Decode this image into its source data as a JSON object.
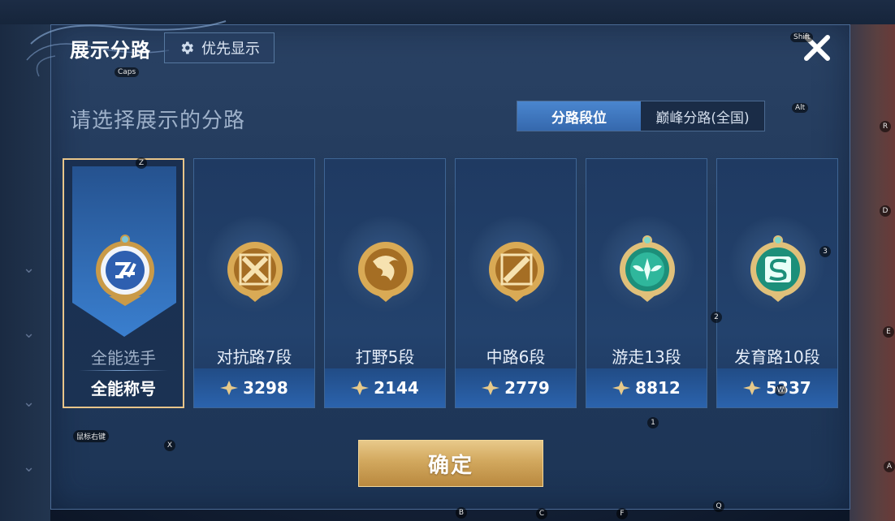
{
  "dialog": {
    "title": "展示分路",
    "priority_label": "优先显示",
    "subtitle": "请选择展示的分路",
    "tabs": [
      {
        "label": "分路段位",
        "active": true
      },
      {
        "label": "巅峰分路(全国)",
        "active": false
      }
    ],
    "confirm_label": "确定"
  },
  "cards": [
    {
      "name": "全能选手",
      "bottom": "全能称号",
      "selected": true,
      "icon": "all-round-badge-icon"
    },
    {
      "name": "对抗路7段",
      "score": "3298",
      "icon": "clash-lane-badge-icon"
    },
    {
      "name": "打野5段",
      "score": "2144",
      "icon": "jungle-badge-icon"
    },
    {
      "name": "中路6段",
      "score": "2779",
      "icon": "mid-lane-badge-icon"
    },
    {
      "name": "游走13段",
      "score": "8812",
      "icon": "roam-badge-icon"
    },
    {
      "name": "发育路10段",
      "score": "5337",
      "icon": "farm-lane-badge-icon"
    }
  ],
  "key_hints": {
    "caps": "Caps",
    "shift": "Shift",
    "alt": "Alt",
    "r": "R",
    "d": "D",
    "e": "E",
    "a": "A",
    "z": "Z",
    "x": "X",
    "b": "B",
    "c": "C",
    "f": "F",
    "q": "Q",
    "w": "W",
    "n1": "1",
    "n2": "2",
    "n3": "3",
    "mouse_right": "鼠标右键"
  },
  "colors": {
    "accent_blue": "#3568ad",
    "gold": "#d2a85e",
    "selected_border": "#e8c58a"
  }
}
